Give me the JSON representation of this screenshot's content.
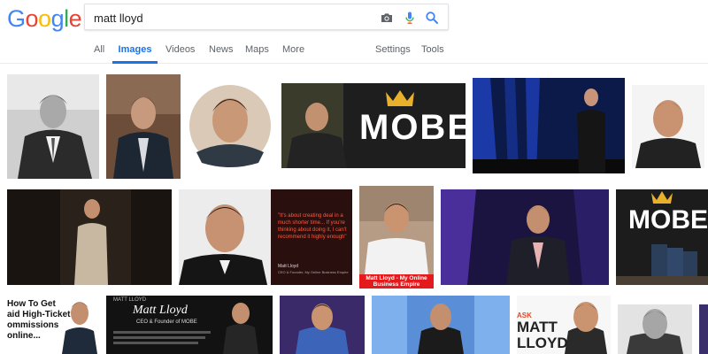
{
  "logo": {
    "letters": [
      "G",
      "o",
      "o",
      "g",
      "l",
      "e"
    ],
    "colors": [
      "#4285f4",
      "#ea4335",
      "#fbbc05",
      "#4285f4",
      "#34a853",
      "#ea4335"
    ]
  },
  "search": {
    "query": "matt lloyd",
    "camera_icon": "camera-icon",
    "mic_icon": "mic-icon",
    "search_icon": "search-icon"
  },
  "nav": {
    "tabs": [
      "All",
      "Images",
      "Videos",
      "News",
      "Maps",
      "More"
    ],
    "active_tab": "Images",
    "settings": "Settings",
    "tools": "Tools"
  },
  "colors": {
    "accent": "#1a73e8",
    "mobe_gold": "#e9b02b",
    "caption_red": "#e41a1c"
  },
  "results": {
    "thumb_mobe_stage_text": "MOBE",
    "thumb_quote": {
      "text": "\"It's about creating deal in a much shorter time... If you're thinking about doing it, I can't recommend it highly enough\"",
      "name": "Matt Lloyd",
      "role": "CEO & Founder, My Online Business Empire"
    },
    "thumb_caption": "Matt Lloyd - My Online Business Empire",
    "thumb_mobe_product_text": "MOBE",
    "thumb_ticket": {
      "line1": "How To Get",
      "line2": "aid High-Ticket",
      "line3": "ommissions",
      "line4": "online..."
    },
    "thumb_ceo": {
      "label": "MATT LLOYD",
      "name": "Matt Lloyd",
      "role": "CEO & Founder of MOBE"
    },
    "thumb_ask": {
      "line1": "ASK",
      "line2": "MATT",
      "line3": "LLOYD"
    }
  }
}
